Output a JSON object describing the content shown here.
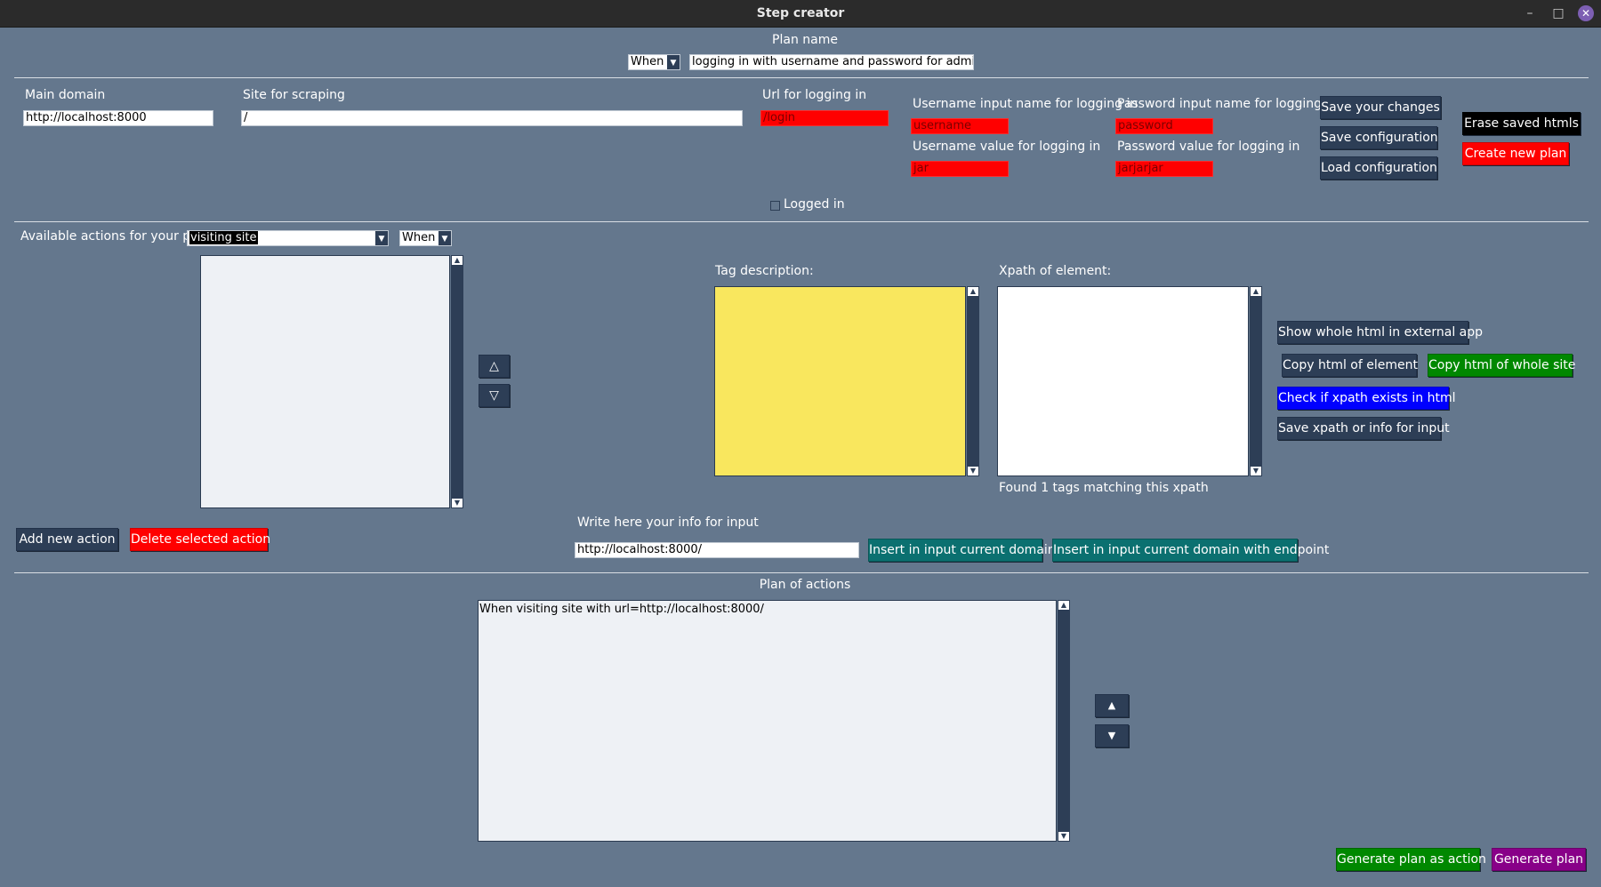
{
  "window": {
    "title": "Step creator",
    "minimize": "–",
    "maximize": "□",
    "close": "✕"
  },
  "plan_name": {
    "label": "Plan name",
    "keyword": "When",
    "value": "logging in with username and password for admin"
  },
  "config": {
    "main_domain_label": "Main domain",
    "main_domain_value": "http://localhost:8000",
    "site_label": "Site for scraping",
    "site_value": "/",
    "login_url_label": "Url for logging in",
    "login_url_value": "/login",
    "username_input_label": "Username input name for logging in",
    "username_input_value": "username",
    "username_value_label": "Username value for logging in",
    "username_value_value": "jar",
    "password_input_label": "Password input name for logging in",
    "password_input_value": "password",
    "password_value_label": "Password value for logging in",
    "password_value_value": "jarjarjar",
    "logged_in_label": "Logged in",
    "buttons": {
      "save_changes": "Save your changes",
      "save_config": "Save configuration",
      "load_config": "Load configuration",
      "erase_htmls": "Erase saved htmls",
      "create_plan": "Create new plan"
    }
  },
  "actions": {
    "label": "Available actions for your plan",
    "selected_action": "visiting site",
    "keyword": "When",
    "move_up": "△",
    "move_down": "▽",
    "add_button": "Add new action",
    "delete_button": "Delete selected action"
  },
  "tag": {
    "description_label": "Tag description:",
    "xpath_label": "Xpath of element:",
    "found_text": "Found 1 tags matching this xpath",
    "buttons": {
      "show_html": "Show whole html in external app",
      "copy_element": "Copy html of element",
      "copy_site": "Copy html of whole site",
      "check_xpath": "Check if xpath exists in html",
      "save_xpath": "Save xpath or info for input"
    }
  },
  "input_info": {
    "label": "Write here your info for input",
    "value": "http://localhost:8000/",
    "insert_domain": "Insert in input current domain",
    "insert_domain_endpoint": "Insert in input current domain with endpoint"
  },
  "plan": {
    "label": "Plan of actions",
    "text": "When visiting site with url=http://localhost:8000/",
    "move_up": "▲",
    "move_down": "▼",
    "generate_as_action": "Generate plan as action",
    "generate_plan": "Generate plan"
  },
  "colors": {
    "background": "#64778d",
    "button": "#2d3e56",
    "danger": "#ff0000",
    "success": "#008800",
    "info": "#0000ff",
    "teal": "#0b7070",
    "purple": "#880088",
    "tag_description_bg": "#f9e75e"
  }
}
